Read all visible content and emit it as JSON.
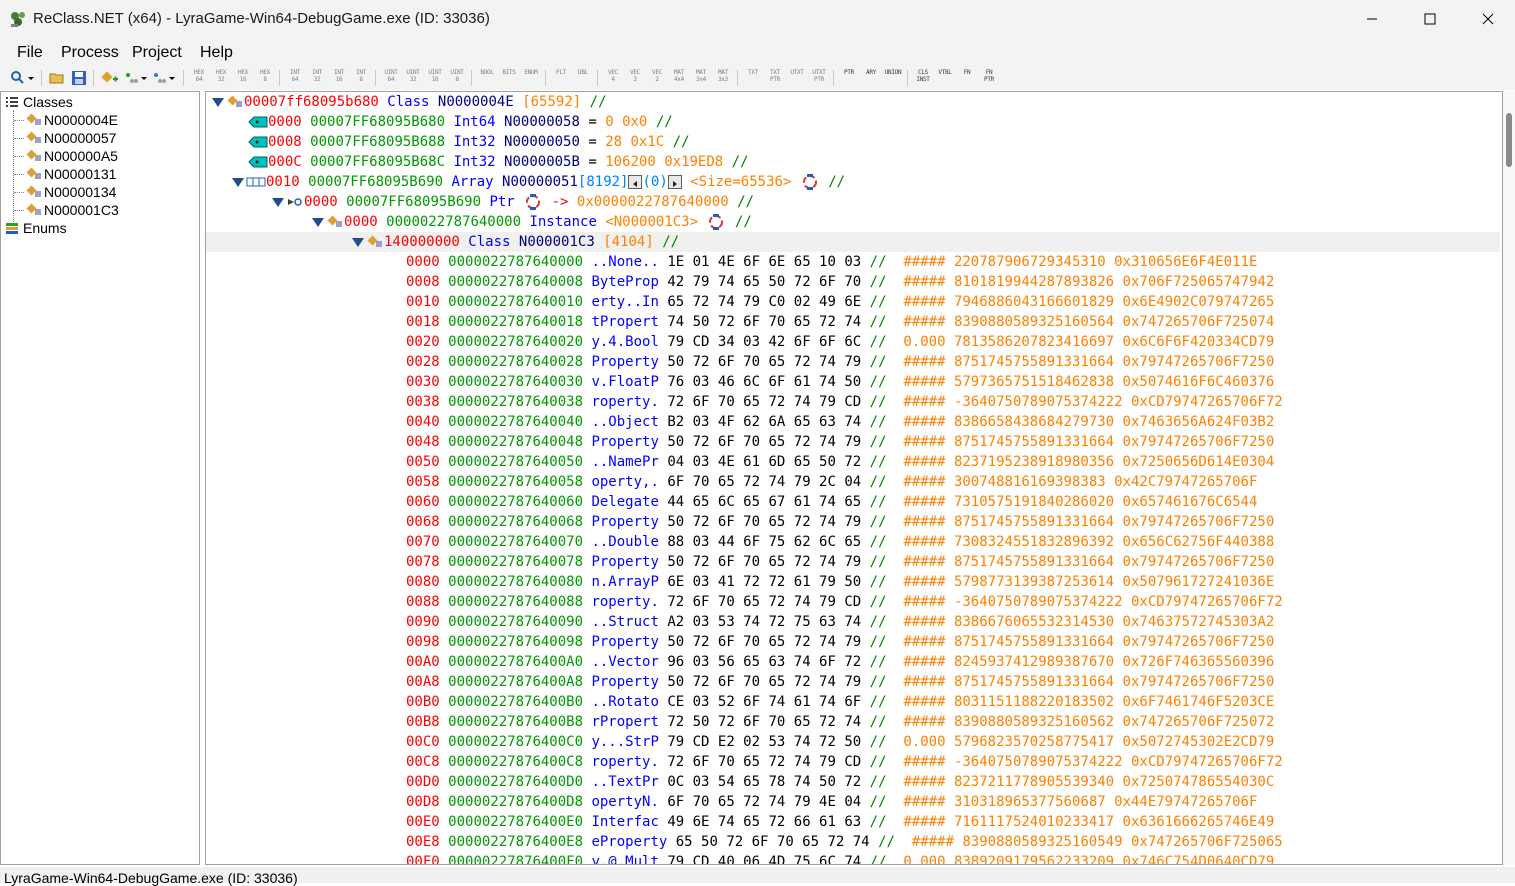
{
  "window": {
    "title": "ReClass.NET (x64) - LyraGame-Win64-DebugGame.exe (ID: 33036)"
  },
  "menu": [
    "File",
    "Process",
    "Project",
    "Help"
  ],
  "toolbar": {
    "type_buttons": [
      {
        "label": "HEX\n64"
      },
      {
        "label": "HEX\n32"
      },
      {
        "label": "HEX\n16"
      },
      {
        "label": "HEX\n8"
      },
      {
        "label": "INT\n64"
      },
      {
        "label": "INT\n32"
      },
      {
        "label": "INT\n16"
      },
      {
        "label": "INT\n8"
      },
      {
        "label": "UINT\n64"
      },
      {
        "label": "UINT\n32"
      },
      {
        "label": "UINT\n16"
      },
      {
        "label": "UINT\n8"
      },
      {
        "label": "BOOL"
      },
      {
        "label": "BITS"
      },
      {
        "label": "ENUM"
      },
      {
        "label": "FLT"
      },
      {
        "label": "DBL"
      },
      {
        "label": "VEC\n4"
      },
      {
        "label": "VEC\n3"
      },
      {
        "label": "VEC\n2"
      },
      {
        "label": "MAT\n4x4"
      },
      {
        "label": "MAT\n3x4"
      },
      {
        "label": "MAT\n3x3"
      },
      {
        "label": "TXT"
      },
      {
        "label": "TXT\nPTR"
      },
      {
        "label": "UTXT"
      },
      {
        "label": "UTXT\nPTR"
      },
      {
        "label": "PTR"
      },
      {
        "label": "ARY"
      },
      {
        "label": "UNION"
      },
      {
        "label": "CLS\nINST"
      },
      {
        "label": "VTBL"
      },
      {
        "label": "FN"
      },
      {
        "label": "FN\nPTR"
      }
    ]
  },
  "tree": {
    "root_label": "Classes",
    "classes": [
      "N0000004E",
      "N00000057",
      "N000000A5",
      "N00000131",
      "N00000134",
      "N000001C3"
    ],
    "enums_label": "Enums"
  },
  "memview": {
    "header": {
      "address": "00007ff68095b680",
      "kw": "Class",
      "name": "N0000004E",
      "size": "[65592]",
      "comment": "//"
    },
    "fields": [
      {
        "offset": "0000",
        "address": "00007FF68095B680",
        "type": "Int64",
        "name": "N00000058",
        "eq": "=",
        "value": "0 0x0",
        "comment": "//"
      },
      {
        "offset": "0008",
        "address": "00007FF68095B688",
        "type": "Int32",
        "name": "N00000050",
        "eq": "=",
        "value": "28 0x1C",
        "comment": "//"
      },
      {
        "offset": "000C",
        "address": "00007FF68095B68C",
        "type": "Int32",
        "name": "N0000005B",
        "eq": "=",
        "value": "106200 0x19ED8",
        "comment": "//"
      }
    ],
    "array": {
      "offset": "0010",
      "address": "00007FF68095B690",
      "type": "Array",
      "name": "N00000051",
      "count": "[8192]",
      "index": "(0)",
      "size": "<Size=65536>",
      "comment": "//"
    },
    "ptr": {
      "offset": "0000",
      "address": "00007FF68095B690",
      "type": "Ptr",
      "arrow": "->",
      "target": "0x0000022787640000",
      "comment": "//"
    },
    "instance": {
      "offset": "0000",
      "address": "0000022787640000",
      "type": "Instance",
      "class": "<N000001C3>",
      "comment": "//"
    },
    "inner_class": {
      "address": "140000000",
      "kw": "Class",
      "name": "N000001C3",
      "size": "[4104]",
      "comment": "//"
    },
    "hex_rows": [
      {
        "off": "0000",
        "addr": "0000022787640000",
        "ascii": "..None..",
        "bytes": "1E 01 4E 6F 6E 65 10 03",
        "cmt": "//",
        "f": "#####",
        "i": "220787906729345310",
        "h": "0x310656E6F4E011E"
      },
      {
        "off": "0008",
        "addr": "0000022787640008",
        "ascii": "ByteProp",
        "bytes": "42 79 74 65 50 72 6F 70",
        "cmt": "//",
        "f": "#####",
        "i": "8101819944287893826",
        "h": "0x706F725065747942"
      },
      {
        "off": "0010",
        "addr": "0000022787640010",
        "ascii": "erty..In",
        "bytes": "65 72 74 79 C0 02 49 6E",
        "cmt": "//",
        "f": "#####",
        "i": "7946886043166601829",
        "h": "0x6E4902C079747265"
      },
      {
        "off": "0018",
        "addr": "0000022787640018",
        "ascii": "tPropert",
        "bytes": "74 50 72 6F 70 65 72 74",
        "cmt": "//",
        "f": "#####",
        "i": "8390880589325160564",
        "h": "0x747265706F725074"
      },
      {
        "off": "0020",
        "addr": "0000022787640020",
        "ascii": "y.4.Bool",
        "bytes": "79 CD 34 03 42 6F 6F 6C",
        "cmt": "//",
        "f": "0.000",
        "i": "7813586207823416697",
        "h": "0x6C6F6F420334CD79"
      },
      {
        "off": "0028",
        "addr": "0000022787640028",
        "ascii": "Property",
        "bytes": "50 72 6F 70 65 72 74 79",
        "cmt": "//",
        "f": "#####",
        "i": "8751745755891331664",
        "h": "0x79747265706F7250"
      },
      {
        "off": "0030",
        "addr": "0000022787640030",
        "ascii": "v.FloatP",
        "bytes": "76 03 46 6C 6F 61 74 50",
        "cmt": "//",
        "f": "#####",
        "i": "5797365751518462838",
        "h": "0x5074616F6C460376"
      },
      {
        "off": "0038",
        "addr": "0000022787640038",
        "ascii": "roperty.",
        "bytes": "72 6F 70 65 72 74 79 CD",
        "cmt": "//",
        "f": "#####",
        "i": "-3640750789075374222",
        "h": "0xCD79747265706F72"
      },
      {
        "off": "0040",
        "addr": "0000022787640040",
        "ascii": "..Object",
        "bytes": "B2 03 4F 62 6A 65 63 74",
        "cmt": "//",
        "f": "#####",
        "i": "8386658438684279730",
        "h": "0x7463656A624F03B2"
      },
      {
        "off": "0048",
        "addr": "0000022787640048",
        "ascii": "Property",
        "bytes": "50 72 6F 70 65 72 74 79",
        "cmt": "//",
        "f": "#####",
        "i": "8751745755891331664",
        "h": "0x79747265706F7250"
      },
      {
        "off": "0050",
        "addr": "0000022787640050",
        "ascii": "..NamePr",
        "bytes": "04 03 4E 61 6D 65 50 72",
        "cmt": "//",
        "f": "#####",
        "i": "8237195238918980356",
        "h": "0x7250656D614E0304"
      },
      {
        "off": "0058",
        "addr": "0000022787640058",
        "ascii": "operty,.",
        "bytes": "6F 70 65 72 74 79 2C 04",
        "cmt": "//",
        "f": "#####",
        "i": "300748816169398383",
        "h": "0x42C79747265706F"
      },
      {
        "off": "0060",
        "addr": "0000022787640060",
        "ascii": "Delegate",
        "bytes": "44 65 6C 65 67 61 74 65",
        "cmt": "//",
        "f": "#####",
        "i": "7310575191840286020",
        "h": "0x657461676C6544"
      },
      {
        "off": "0068",
        "addr": "0000022787640068",
        "ascii": "Property",
        "bytes": "50 72 6F 70 65 72 74 79",
        "cmt": "//",
        "f": "#####",
        "i": "8751745755891331664",
        "h": "0x79747265706F7250"
      },
      {
        "off": "0070",
        "addr": "0000022787640070",
        "ascii": "..Double",
        "bytes": "88 03 44 6F 75 62 6C 65",
        "cmt": "//",
        "f": "#####",
        "i": "7308324551832896392",
        "h": "0x656C62756F440388"
      },
      {
        "off": "0078",
        "addr": "0000022787640078",
        "ascii": "Property",
        "bytes": "50 72 6F 70 65 72 74 79",
        "cmt": "//",
        "f": "#####",
        "i": "8751745755891331664",
        "h": "0x79747265706F7250"
      },
      {
        "off": "0080",
        "addr": "0000022787640080",
        "ascii": "n.ArrayP",
        "bytes": "6E 03 41 72 72 61 79 50",
        "cmt": "//",
        "f": "#####",
        "i": "5798773139387253614",
        "h": "0x507961727241036E"
      },
      {
        "off": "0088",
        "addr": "0000022787640088",
        "ascii": "roperty.",
        "bytes": "72 6F 70 65 72 74 79 CD",
        "cmt": "//",
        "f": "#####",
        "i": "-3640750789075374222",
        "h": "0xCD79747265706F72"
      },
      {
        "off": "0090",
        "addr": "0000022787640090",
        "ascii": "..Struct",
        "bytes": "A2 03 53 74 72 75 63 74",
        "cmt": "//",
        "f": "#####",
        "i": "8386676065532314530",
        "h": "0x74637572745303A2"
      },
      {
        "off": "0098",
        "addr": "0000022787640098",
        "ascii": "Property",
        "bytes": "50 72 6F 70 65 72 74 79",
        "cmt": "//",
        "f": "#####",
        "i": "8751745755891331664",
        "h": "0x79747265706F7250"
      },
      {
        "off": "00A0",
        "addr": "00000227876400A0",
        "ascii": "..Vector",
        "bytes": "96 03 56 65 63 74 6F 72",
        "cmt": "//",
        "f": "#####",
        "i": "8245937412989387670",
        "h": "0x726F746365560396"
      },
      {
        "off": "00A8",
        "addr": "00000227876400A8",
        "ascii": "Property",
        "bytes": "50 72 6F 70 65 72 74 79",
        "cmt": "//",
        "f": "#####",
        "i": "8751745755891331664",
        "h": "0x79747265706F7250"
      },
      {
        "off": "00B0",
        "addr": "00000227876400B0",
        "ascii": "..Rotato",
        "bytes": "CE 03 52 6F 74 61 74 6F",
        "cmt": "//",
        "f": "#####",
        "i": "8031151188220183502",
        "h": "0x6F7461746F5203CE"
      },
      {
        "off": "00B8",
        "addr": "00000227876400B8",
        "ascii": "rPropert",
        "bytes": "72 50 72 6F 70 65 72 74",
        "cmt": "//",
        "f": "#####",
        "i": "8390880589325160562",
        "h": "0x747265706F725072"
      },
      {
        "off": "00C0",
        "addr": "00000227876400C0",
        "ascii": "y...StrP",
        "bytes": "79 CD E2 02 53 74 72 50",
        "cmt": "//",
        "f": "0.000",
        "i": "5796823570258775417",
        "h": "0x5072745302E2CD79"
      },
      {
        "off": "00C8",
        "addr": "00000227876400C8",
        "ascii": "roperty.",
        "bytes": "72 6F 70 65 72 74 79 CD",
        "cmt": "//",
        "f": "#####",
        "i": "-3640750789075374222",
        "h": "0xCD79747265706F72"
      },
      {
        "off": "00D0",
        "addr": "00000227876400D0",
        "ascii": "..TextPr",
        "bytes": "0C 03 54 65 78 74 50 72",
        "cmt": "//",
        "f": "#####",
        "i": "8237211778905539340",
        "h": "0x725074786554030C"
      },
      {
        "off": "00D8",
        "addr": "00000227876400D8",
        "ascii": "opertyN.",
        "bytes": "6F 70 65 72 74 79 4E 04",
        "cmt": "//",
        "f": "#####",
        "i": "310318965377560687",
        "h": "0x44E79747265706F"
      },
      {
        "off": "00E0",
        "addr": "00000227876400E0",
        "ascii": "Interfac",
        "bytes": "49 6E 74 65 72 66 61 63",
        "cmt": "//",
        "f": "#####",
        "i": "7161117524010233417",
        "h": "0x6361666265746E49"
      },
      {
        "off": "00E8",
        "addr": "00000227876400E8",
        "ascii": "eProperty",
        "bytes": "65 50 72 6F 70 65 72 74",
        "cmt": "//",
        "f": "#####",
        "i": "8390880589325160549",
        "h": "0x747265706F725065"
      },
      {
        "off": "00F0",
        "addr": "00000227876400F0",
        "ascii": "y.@.Mult",
        "bytes": "79 CD 40 06 4D 75 6C 74",
        "cmt": "//",
        "f": "0.000",
        "i": "8389209179562233209",
        "h": "0x746C754D0640CD79"
      }
    ]
  },
  "statusbar": {
    "text": "LyraGame-Win64-DebugGame.exe (ID: 33036)"
  },
  "colors": {
    "offset": "#ff0000",
    "address": "#009900",
    "type": "#0000ff",
    "value": "#ff8000"
  }
}
